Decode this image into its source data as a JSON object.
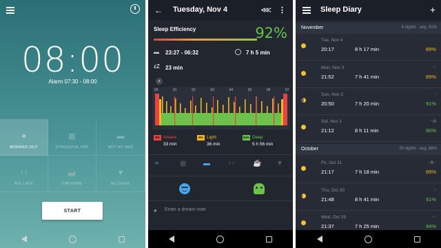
{
  "alarm": {
    "time": "08:00",
    "range": "Alarm 07:30 - 08:00",
    "start_label": "START",
    "tags": [
      {
        "label": "WORKED OUT",
        "icon": "running-icon",
        "active": true
      },
      {
        "label": "STRESSFUL DAY",
        "icon": "building-icon",
        "active": false
      },
      {
        "label": "NOT MY BED",
        "icon": "bed-icon",
        "active": false
      },
      {
        "label": "ATE LATE",
        "icon": "fork-knife-icon",
        "active": false
      },
      {
        "label": "CAFFEINE",
        "icon": "coffee-icon",
        "active": false
      },
      {
        "label": "ALCOHOL",
        "icon": "wine-glass-icon",
        "active": false
      }
    ]
  },
  "detail": {
    "title": "Tuesday, Nov 4",
    "efficiency_label": "Sleep Efficiency",
    "efficiency_value": "92%",
    "bedtime_range": "23:27 - 06:32",
    "time_in_bed": "7 h 5 min",
    "fall_asleep": "23 min",
    "hours": [
      "00",
      "01",
      "02",
      "03",
      "04",
      "05",
      "06",
      "07"
    ],
    "awake": {
      "pct": "8%",
      "name": "Awake",
      "time": "33 min",
      "color": "#e84343"
    },
    "light": {
      "pct": "8%",
      "name": "Light",
      "time": "36 min",
      "color": "#f3b722"
    },
    "deep": {
      "pct": "84%",
      "name": "Deep",
      "time": "5 h 56 min",
      "color": "#6cc24a"
    },
    "dream_placeholder": "Enter a dream note"
  },
  "diary": {
    "title": "Sleep Diary",
    "months": [
      {
        "name": "November",
        "stat": "4 nights  ·  avg. 91%"
      },
      {
        "name": "October",
        "stat": "20 nights  ·  avg. 88%"
      }
    ],
    "entries": [
      {
        "date": "Tue, Nov 4",
        "time": "20:17",
        "dur": "8 h 17 min",
        "eff": "89%",
        "eff_color": "#f3b722",
        "moon": "full",
        "tags": ""
      },
      {
        "date": "Mon, Nov 3",
        "time": "21:52",
        "dur": "7 h 41 min",
        "eff": "89%",
        "eff_color": "#f3b722",
        "moon": "full",
        "tags": "↑↑"
      },
      {
        "date": "Sun, Nov 2",
        "time": "20:50",
        "dur": "7 h 20 min",
        "eff": "91%",
        "eff_color": "#6cc24a",
        "moon": "half",
        "tags": "~"
      },
      {
        "date": "Sat, Nov 1",
        "time": "21:12",
        "dur": "8 h 11 min",
        "eff": "90%",
        "eff_color": "#6cc24a",
        "moon": "full",
        "tags": "~ ▤"
      },
      {
        "date": "Fri, Oct 31",
        "time": "21:17",
        "dur": "7 h 18 min",
        "eff": "89%",
        "eff_color": "#f3b722",
        "moon": "full",
        "tags": "↑ ▤ ↑"
      },
      {
        "date": "Thu, Oct 30",
        "time": "21:48",
        "dur": "8 h 41 min",
        "eff": "91%",
        "eff_color": "#6cc24a",
        "moon": "gib",
        "tags": "~"
      },
      {
        "date": "Wed, Oct 29",
        "time": "21:37",
        "dur": "7 h 25 min",
        "eff": "94%",
        "eff_color": "#6cc24a",
        "moon": "full",
        "tags": "~ ↑"
      }
    ]
  }
}
